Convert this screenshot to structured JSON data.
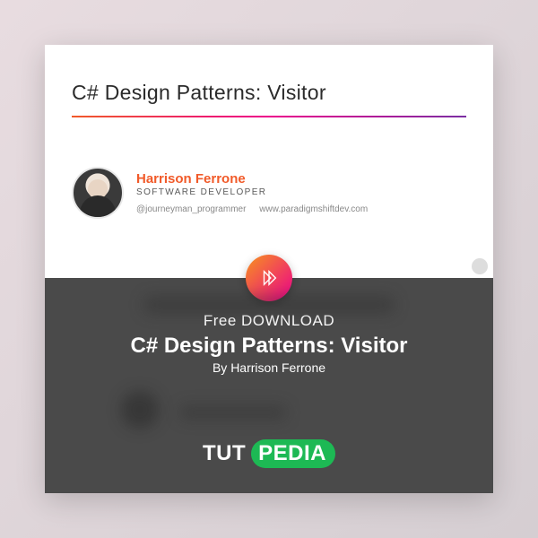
{
  "top": {
    "title": "C# Design Patterns: Visitor",
    "author": {
      "name": "Harrison Ferrone",
      "role": "SOFTWARE DEVELOPER",
      "handle": "@journeyman_programmer",
      "site": "www.paradigmshiftdev.com"
    }
  },
  "bottom": {
    "label": "Free DOWNLOAD",
    "title": "C# Design Patterns: Visitor",
    "byline": "By Harrison Ferrone"
  },
  "brand": {
    "part1": "TUT",
    "part2": "PEDIA"
  }
}
